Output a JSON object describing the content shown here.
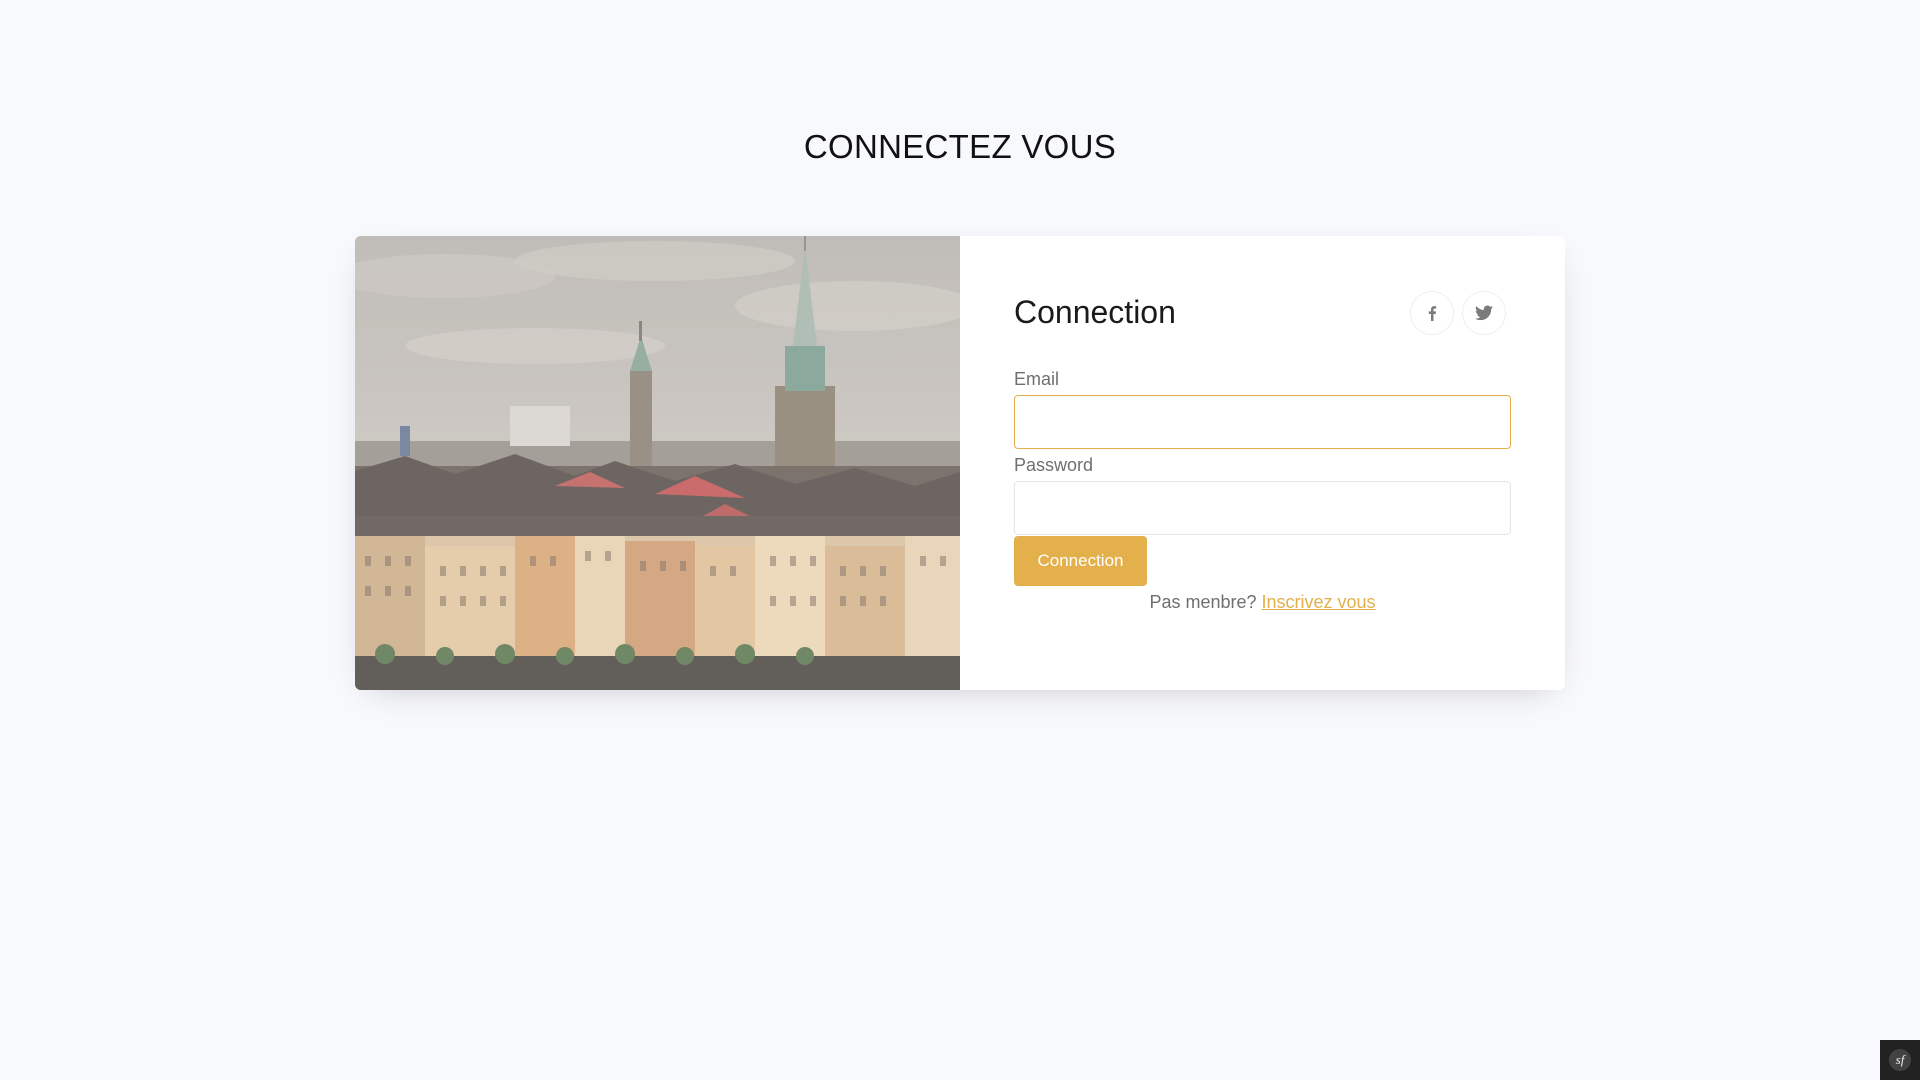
{
  "page": {
    "title": "CONNECTEZ VOUS"
  },
  "card": {
    "hero_image": "city-skyline-photo",
    "form_title": "Connection",
    "social": {
      "facebook_icon": "facebook-icon",
      "twitter_icon": "twitter-icon"
    },
    "email": {
      "label": "Email",
      "value": "",
      "placeholder": ""
    },
    "password": {
      "label": "Password",
      "value": "",
      "placeholder": ""
    },
    "submit_label": "Connection",
    "signup_prompt": "Pas menbre?",
    "signup_link": "Inscrivez vous"
  },
  "badge": {
    "icon": "symfony-icon"
  },
  "colors": {
    "accent": "#e3b04b",
    "background": "#f8f9fd",
    "card": "#ffffff",
    "text_muted": "#6f6f6f"
  }
}
